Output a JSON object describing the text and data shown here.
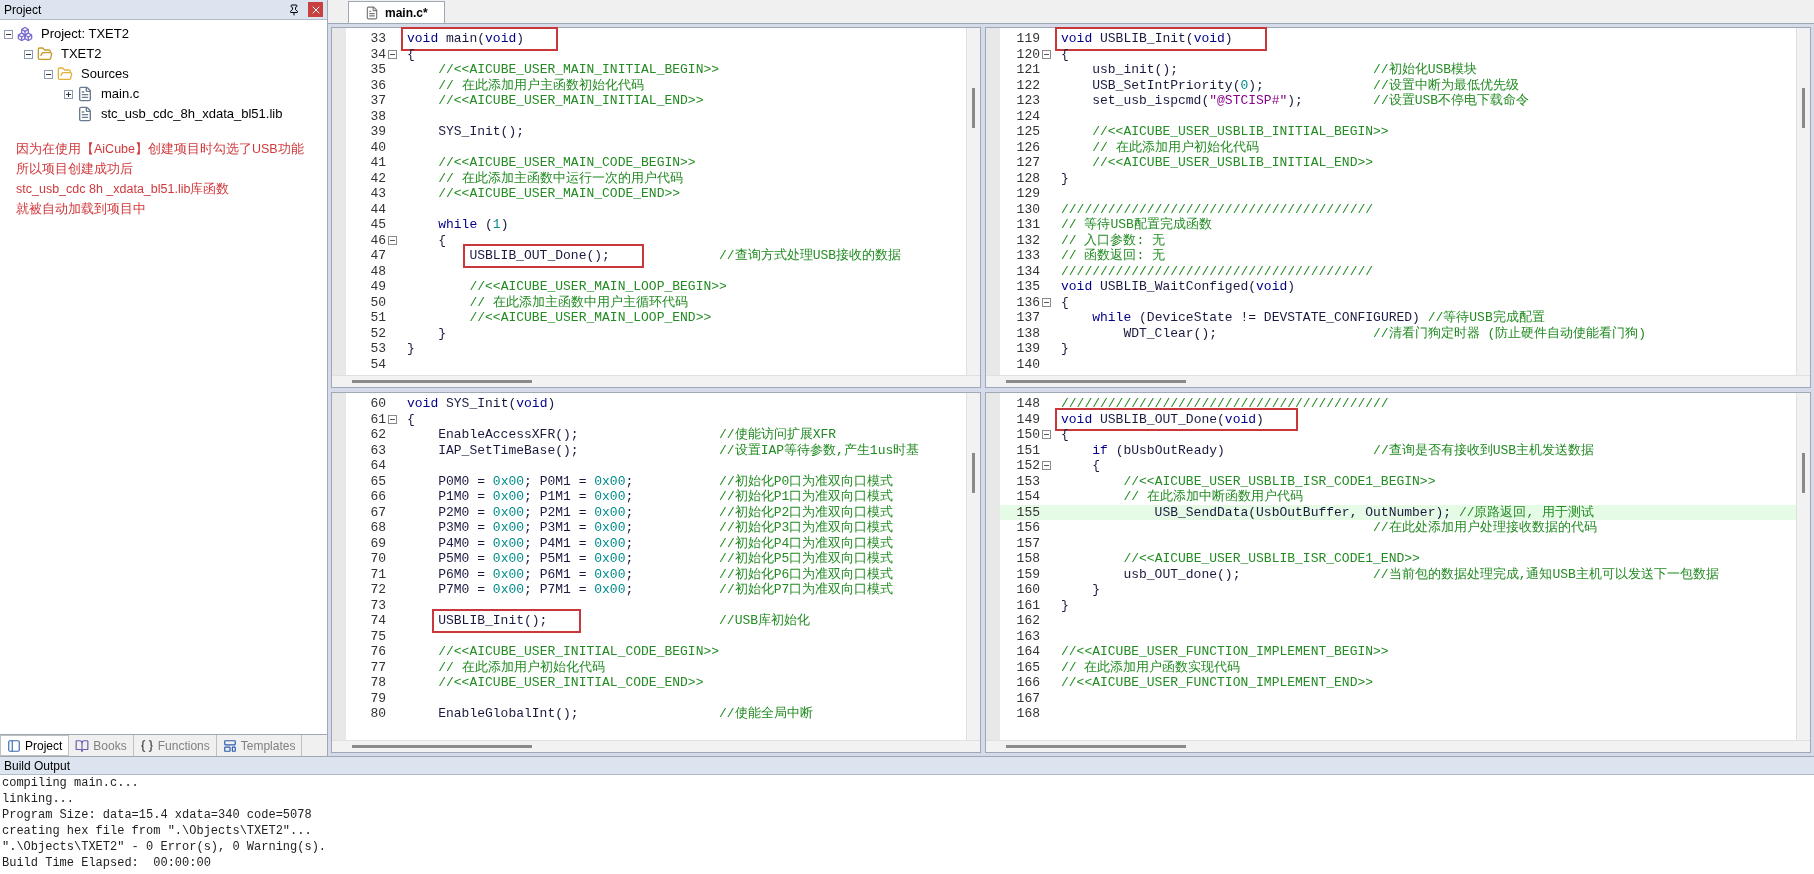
{
  "project_panel": {
    "title": "Project",
    "tree": [
      {
        "label": "Project: TXET2",
        "kind": "project",
        "expanded": true,
        "children": [
          {
            "label": "TXET2",
            "kind": "target",
            "expanded": true,
            "children": [
              {
                "label": "Sources",
                "kind": "folder",
                "expanded": true,
                "children": [
                  {
                    "label": "main.c",
                    "kind": "file",
                    "expanded": false
                  },
                  {
                    "label": "stc_usb_cdc_8h_xdata_bl51.lib",
                    "kind": "file"
                  }
                ]
              }
            ]
          }
        ]
      }
    ],
    "annotation": [
      "因为在使用【AiCube】创建项目时勾选了USB功能",
      "所以项目创建成功后",
      "stc_usb_cdc 8h _xdata_bl51.lib库函数",
      "就被自动加载到项目中"
    ],
    "tabs": [
      {
        "label": "Project",
        "kind": "project",
        "selected": true
      },
      {
        "label": "Books",
        "kind": "books",
        "selected": false
      },
      {
        "label": "Functions",
        "kind": "functions",
        "selected": false
      },
      {
        "label": "Templates",
        "kind": "templates",
        "selected": false
      }
    ]
  },
  "editor": {
    "tabs": [
      {
        "label": "main.c*",
        "selected": true
      }
    ],
    "panes": [
      {
        "lines": [
          {
            "number": "33",
            "text": "void main(void)",
            "boxed": true
          },
          {
            "number": "34",
            "text": "{",
            "fold": true
          },
          {
            "number": "35",
            "text": "    //<<AICUBE_USER_MAIN_INITIAL_BEGIN>>"
          },
          {
            "number": "36",
            "text": "    // 在此添加用户主函数初始化代码"
          },
          {
            "number": "37",
            "text": "    //<<AICUBE_USER_MAIN_INITIAL_END>>"
          },
          {
            "number": "38"
          },
          {
            "number": "39",
            "text": "    SYS_Init();"
          },
          {
            "number": "40"
          },
          {
            "number": "41",
            "text": "    //<<AICUBE_USER_MAIN_CODE_BEGIN>>"
          },
          {
            "number": "42",
            "text": "    // 在此添加主函数中运行一次的用户代码"
          },
          {
            "number": "43",
            "text": "    //<<AICUBE_USER_MAIN_CODE_END>>"
          },
          {
            "number": "44"
          },
          {
            "number": "45",
            "text": "    while (1)"
          },
          {
            "number": "46",
            "text": "    {",
            "fold": true
          },
          {
            "number": "47",
            "text": "        USBLIB_OUT_Done();              //查询方式处理USB接收的数据",
            "boxed": true
          },
          {
            "number": "48"
          },
          {
            "number": "49",
            "text": "        //<<AICUBE_USER_MAIN_LOOP_BEGIN>>"
          },
          {
            "number": "50",
            "text": "        // 在此添加主函数中用户主循环代码"
          },
          {
            "number": "51",
            "text": "        //<<AICUBE_USER_MAIN_LOOP_END>>"
          },
          {
            "number": "52",
            "text": "    }"
          },
          {
            "number": "53",
            "text": "}"
          },
          {
            "number": "54"
          }
        ]
      },
      {
        "lines": [
          {
            "number": "119",
            "text": "void USBLIB_Init(void)",
            "boxed": true
          },
          {
            "number": "120",
            "text": "{",
            "fold": true
          },
          {
            "number": "121",
            "text": "    usb_init();                         //初始化USB模块"
          },
          {
            "number": "122",
            "text": "    USB_SetIntPriority(0);              //设置中断为最低优先级"
          },
          {
            "number": "123",
            "text": "    set_usb_ispcmd(\"@STCISP#\");         //设置USB不停电下载命令"
          },
          {
            "number": "124"
          },
          {
            "number": "125",
            "text": "    //<<AICUBE_USER_USBLIB_INITIAL_BEGIN>>"
          },
          {
            "number": "126",
            "text": "    // 在此添加用户初始化代码"
          },
          {
            "number": "127",
            "text": "    //<<AICUBE_USER_USBLIB_INITIAL_END>>"
          },
          {
            "number": "128",
            "text": "}"
          },
          {
            "number": "129"
          },
          {
            "number": "130",
            "text": "////////////////////////////////////////"
          },
          {
            "number": "131",
            "text": "// 等待USB配置完成函数"
          },
          {
            "number": "132",
            "text": "// 入口参数: 无"
          },
          {
            "number": "133",
            "text": "// 函数返回: 无"
          },
          {
            "number": "134",
            "text": "////////////////////////////////////////"
          },
          {
            "number": "135",
            "text": "void USBLIB_WaitConfiged(void)"
          },
          {
            "number": "136",
            "text": "{",
            "fold": true
          },
          {
            "number": "137",
            "text": "    while (DeviceState != DEVSTATE_CONFIGURED) //等待USB完成配置"
          },
          {
            "number": "138",
            "text": "        WDT_Clear();                    //清看门狗定时器 (防止硬件自动使能看门狗)"
          },
          {
            "number": "139",
            "text": "}"
          },
          {
            "number": "140"
          }
        ]
      },
      {
        "lines": [
          {
            "number": "60",
            "text": "void SYS_Init(void)"
          },
          {
            "number": "61",
            "text": "{",
            "fold": true
          },
          {
            "number": "62",
            "text": "    EnableAccessXFR();                  //使能访问扩展XFR"
          },
          {
            "number": "63",
            "text": "    IAP_SetTimeBase();                  //设置IAP等待参数,产生1us时基"
          },
          {
            "number": "64"
          },
          {
            "number": "65",
            "text": "    P0M0 = 0x00; P0M1 = 0x00;           //初始化P0口为准双向口模式"
          },
          {
            "number": "66",
            "text": "    P1M0 = 0x00; P1M1 = 0x00;           //初始化P1口为准双向口模式"
          },
          {
            "number": "67",
            "text": "    P2M0 = 0x00; P2M1 = 0x00;           //初始化P2口为准双向口模式"
          },
          {
            "number": "68",
            "text": "    P3M0 = 0x00; P3M1 = 0x00;           //初始化P3口为准双向口模式"
          },
          {
            "number": "69",
            "text": "    P4M0 = 0x00; P4M1 = 0x00;           //初始化P4口为准双向口模式"
          },
          {
            "number": "70",
            "text": "    P5M0 = 0x00; P5M1 = 0x00;           //初始化P5口为准双向口模式"
          },
          {
            "number": "71",
            "text": "    P6M0 = 0x00; P6M1 = 0x00;           //初始化P6口为准双向口模式"
          },
          {
            "number": "72",
            "text": "    P7M0 = 0x00; P7M1 = 0x00;           //初始化P7口为准双向口模式"
          },
          {
            "number": "73"
          },
          {
            "number": "74",
            "text": "    USBLIB_Init();                      //USB库初始化",
            "boxed": true
          },
          {
            "number": "75"
          },
          {
            "number": "76",
            "text": "    //<<AICUBE_USER_INITIAL_CODE_BEGIN>>"
          },
          {
            "number": "77",
            "text": "    // 在此添加用户初始化代码"
          },
          {
            "number": "78",
            "text": "    //<<AICUBE_USER_INITIAL_CODE_END>>"
          },
          {
            "number": "79"
          },
          {
            "number": "80",
            "text": "    EnableGlobalInt();                  //使能全局中断"
          }
        ]
      },
      {
        "lines": [
          {
            "number": "148",
            "text": "//////////////////////////////////////////"
          },
          {
            "number": "149",
            "text": "void USBLIB_OUT_Done(void)",
            "boxed": true
          },
          {
            "number": "150",
            "text": "{",
            "fold": true
          },
          {
            "number": "151",
            "text": "    if (bUsbOutReady)                   //查询是否有接收到USB主机发送数据"
          },
          {
            "number": "152",
            "text": "    {",
            "fold": true
          },
          {
            "number": "153",
            "text": "        //<<AICUBE_USER_USBLIB_ISR_CODE1_BEGIN>>"
          },
          {
            "number": "154",
            "text": "        // 在此添加中断函数用户代码"
          },
          {
            "number": "155",
            "text": "            USB_SendData(UsbOutBuffer, OutNumber); //原路返回, 用于测试",
            "current": true
          },
          {
            "number": "156",
            "text": "                                        //在此处添加用户处理接收数据的代码"
          },
          {
            "number": "157"
          },
          {
            "number": "158",
            "text": "        //<<AICUBE_USER_USBLIB_ISR_CODE1_END>>"
          },
          {
            "number": "159",
            "text": "        usb_OUT_done();                 //当前包的数据处理完成,通知USB主机可以发送下一包数据"
          },
          {
            "number": "160",
            "text": "    }"
          },
          {
            "number": "161",
            "text": "}"
          },
          {
            "number": "162"
          },
          {
            "number": "163"
          },
          {
            "number": "164",
            "text": "//<<AICUBE_USER_FUNCTION_IMPLEMENT_BEGIN>>"
          },
          {
            "number": "165",
            "text": "// 在此添加用户函数实现代码"
          },
          {
            "number": "166",
            "text": "//<<AICUBE_USER_FUNCTION_IMPLEMENT_END>>"
          },
          {
            "number": "167"
          },
          {
            "number": "168"
          }
        ]
      }
    ]
  },
  "build_output": {
    "title": "Build Output",
    "lines": [
      "compiling main.c...",
      "linking...",
      "Program Size: data=15.4 xdata=340 code=5078",
      "creating hex file from \".\\Objects\\TXET2\"...",
      "\".\\Objects\\TXET2\" - 0 Error(s), 0 Warning(s).",
      "Build Time Elapsed:  00:00:00"
    ]
  }
}
